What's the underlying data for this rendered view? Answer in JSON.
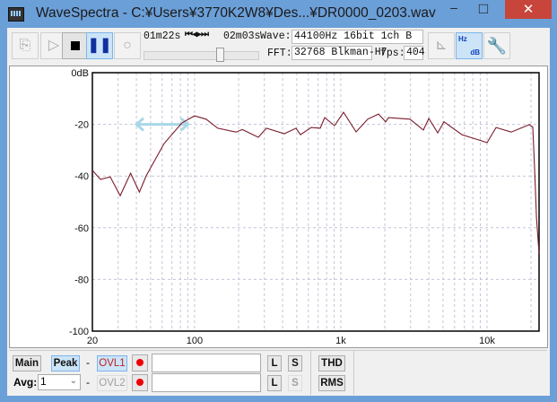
{
  "window": {
    "title": "WaveSpectra - C:¥Users¥3770K2W8¥Des...¥DR0000_0203.wav",
    "minimize": "–",
    "maximize": "□",
    "close": "✕"
  },
  "toolbar": {
    "position": "01m22s",
    "transport": "⏮◀▶⏭",
    "duration": "02m03s",
    "wave_label": "Wave:",
    "wave_value": "44100Hz 16bit 1ch B",
    "fft_label": "FFT:",
    "fft_value": "32768 Blkman-H7",
    "fps_label": "fps:",
    "fps_value": "404",
    "seek_fraction": 0.66,
    "hz_db_top": "Hz",
    "hz_db_bottom": "dB"
  },
  "bottom": {
    "main": "Main",
    "peak": "Peak",
    "dash": "-",
    "ovl1": "OVL1",
    "ovl2": "OVL2",
    "avg_label": "Avg:",
    "avg_value": "1",
    "l": "L",
    "s": "S",
    "thd": "THD",
    "rms": "RMS",
    "ovl1_text": "",
    "ovl2_text": ""
  },
  "chart_data": {
    "type": "line",
    "xscale": "log",
    "xlim": [
      20,
      22700
    ],
    "ylim": [
      -100,
      0
    ],
    "x_ticks": [
      {
        "v": 20,
        "label": "20"
      },
      {
        "v": 100,
        "label": "100"
      },
      {
        "v": 1000,
        "label": "1k"
      },
      {
        "v": 10000,
        "label": "10k"
      }
    ],
    "y_ticks": [
      {
        "v": 0,
        "label": "0dB"
      },
      {
        "v": -20,
        "label": "-20"
      },
      {
        "v": -40,
        "label": "-40"
      },
      {
        "v": -60,
        "label": "-60"
      },
      {
        "v": -80,
        "label": "-80"
      },
      {
        "v": -100,
        "label": "-100"
      }
    ],
    "grid": true,
    "series": [
      {
        "name": "spectrum",
        "color": "#7a1a2a",
        "x": [
          20,
          22.7,
          26.5,
          31,
          36.5,
          41.9,
          46.7,
          61.9,
          82,
          100,
          120,
          144,
          192,
          212,
          273,
          310,
          411,
          494,
          530,
          628,
          723,
          776,
          906,
          1044,
          1273,
          1528,
          1812,
          2028,
          2118,
          2972,
          3672,
          4000,
          4600,
          5080,
          6740,
          9200,
          10000,
          11540,
          14660,
          19460,
          20560,
          21180,
          21780,
          22700
        ],
        "y": [
          -37.8,
          -41.3,
          -40.3,
          -47.6,
          -38.9,
          -46.2,
          -39.9,
          -27.4,
          -19.4,
          -16.7,
          -18,
          -21.5,
          -23,
          -22,
          -25,
          -21.5,
          -23.6,
          -21.5,
          -24,
          -21.2,
          -21.5,
          -17.4,
          -20.5,
          -15.3,
          -22.9,
          -18,
          -16,
          -19,
          -17.4,
          -18,
          -22.2,
          -17.7,
          -23.3,
          -19,
          -24,
          -26.4,
          -27.1,
          -21.2,
          -23,
          -20.1,
          -21,
          -37.8,
          -56,
          -70
        ]
      }
    ],
    "annotations": [
      {
        "type": "double-arrow",
        "x": [
          40,
          90
        ],
        "y": -20,
        "color": "#a8d8e8"
      }
    ]
  }
}
